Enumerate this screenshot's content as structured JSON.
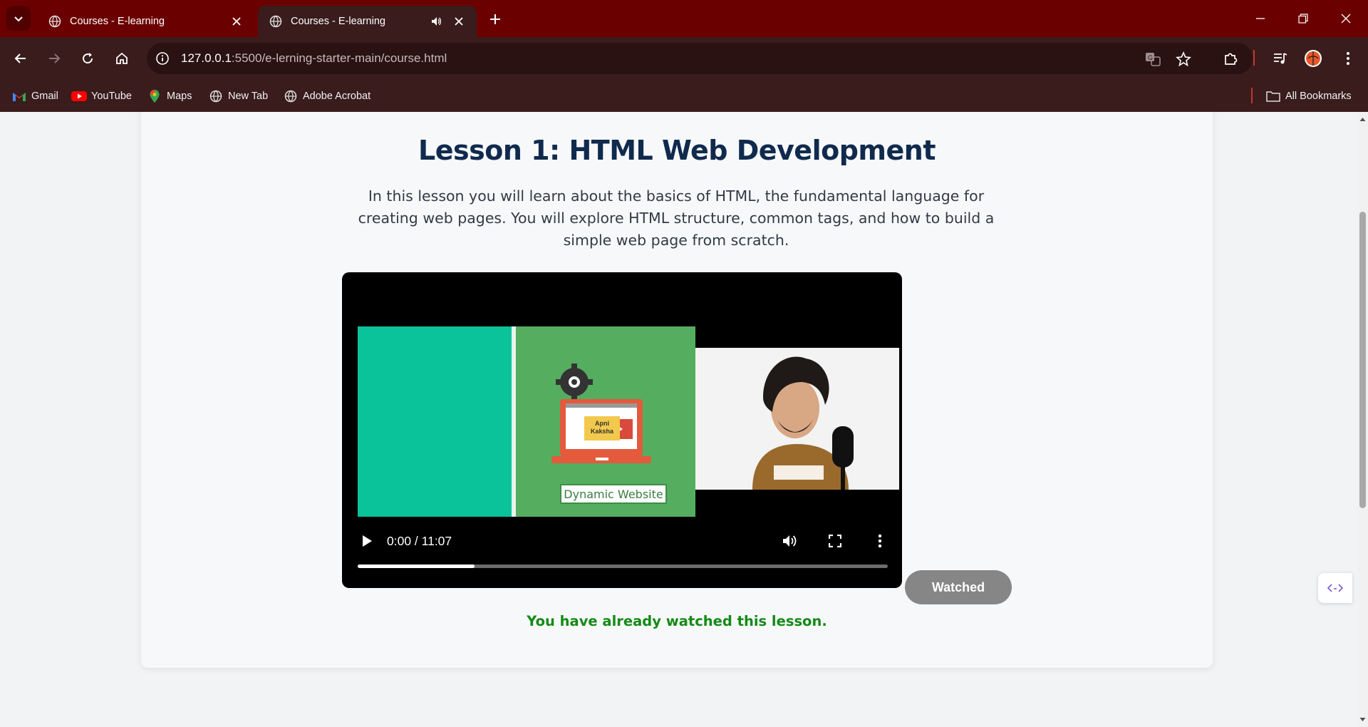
{
  "browser": {
    "tabs": [
      {
        "title": "Courses - E-learning",
        "active": false,
        "audio": false
      },
      {
        "title": "Courses - E-learning",
        "active": true,
        "audio": true
      }
    ],
    "url_host": "127.0.0.1",
    "url_path": ":5500/e-lerning-starter-main/course.html",
    "bookmarks": [
      {
        "label": "Gmail",
        "icon": "gmail-icon"
      },
      {
        "label": "YouTube",
        "icon": "youtube-icon"
      },
      {
        "label": "Maps",
        "icon": "maps-icon"
      },
      {
        "label": "New Tab",
        "icon": "globe-icon"
      },
      {
        "label": "Adobe Acrobat",
        "icon": "globe-icon"
      }
    ],
    "all_bookmarks_label": "All Bookmarks",
    "colors": {
      "frame": "#6b0000",
      "toolbar": "#3a1c1c"
    }
  },
  "lesson": {
    "title": "Lesson 1: HTML Web Development",
    "description": "In this lesson you will learn about the basics of HTML, the fundamental language for creating web pages. You will explore HTML structure, common tags, and how to build a simple web page from scratch.",
    "video": {
      "time": "0:00 / 11:07",
      "buffered_fraction": 0.22,
      "thumbnail_label": "Dynamic Website",
      "thumbnail_badge": "Apni Kaksha"
    },
    "watched_button": "Watched",
    "watched_message": "You have already watched this lesson.",
    "colors": {
      "title": "#0f2a4d",
      "message": "#138a15",
      "button": "#868686"
    }
  }
}
